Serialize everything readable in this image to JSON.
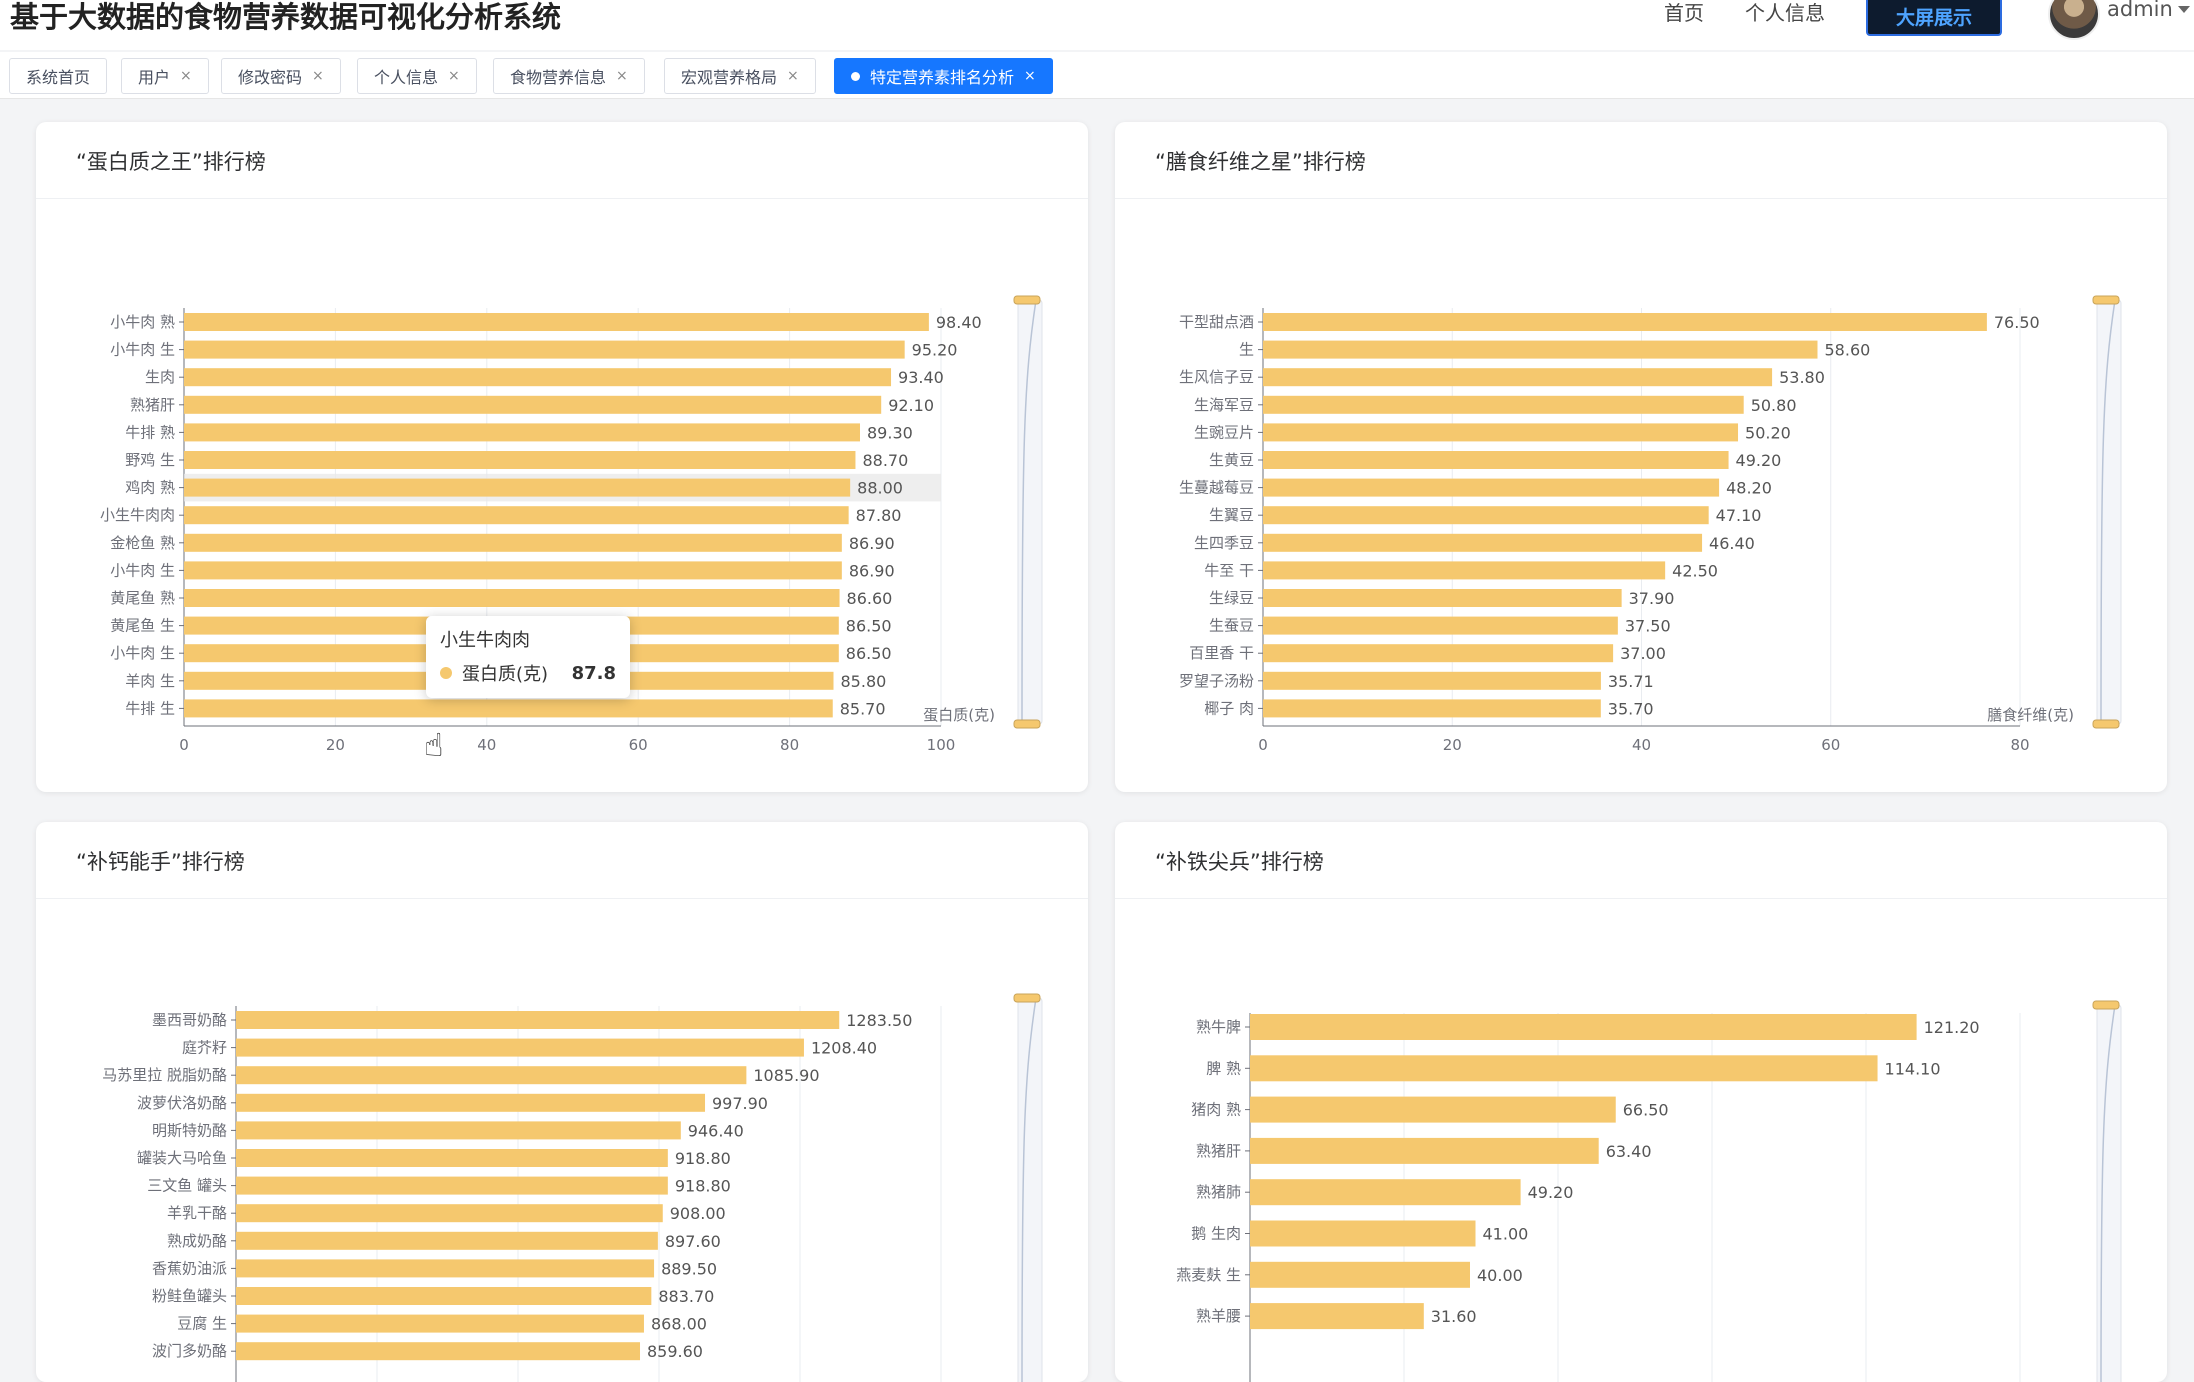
{
  "header": {
    "title": "基于大数据的食物营养数据可视化分析系统",
    "nav": [
      "首页",
      "个人信息"
    ],
    "screen_button": "大屏展示",
    "username": "admin"
  },
  "tabs": [
    {
      "label": "系统首页",
      "closable": false,
      "active": false
    },
    {
      "label": "用户",
      "closable": true,
      "active": false
    },
    {
      "label": "修改密码",
      "closable": true,
      "active": false
    },
    {
      "label": "个人信息",
      "closable": true,
      "active": false
    },
    {
      "label": "食物营养信息",
      "closable": true,
      "active": false
    },
    {
      "label": "宏观营养格局",
      "closable": true,
      "active": false
    },
    {
      "label": "特定营养素排名分析",
      "closable": true,
      "active": true
    }
  ],
  "close_glyph": "×",
  "colors": {
    "bar": "#f5c86e",
    "active_tab": "#1677ff",
    "highlight": "#e8e8e8"
  },
  "tooltip": {
    "title": "小生牛肉肉",
    "series": "蛋白质(克)",
    "value": "87.8"
  },
  "chart_data": [
    {
      "type": "bar",
      "orientation": "horizontal",
      "title": "“蛋白质之王”排行榜",
      "xlabel": "蛋白质(克)",
      "xlim": [
        0,
        100
      ],
      "xticks": [
        0,
        20,
        40,
        60,
        80,
        100
      ],
      "highlight_index": 6,
      "categories": [
        "小牛肉 熟",
        "小牛肉 生",
        "生肉",
        "熟猪肝",
        "牛排 熟",
        "野鸡 生",
        "鸡肉 熟",
        "小生牛肉肉",
        "金枪鱼 熟",
        "小牛肉 生",
        "黄尾鱼 熟",
        "黄尾鱼 生",
        "小牛肉 生",
        "羊肉 生",
        "牛排 生"
      ],
      "values": [
        98.4,
        95.2,
        93.4,
        92.1,
        89.3,
        88.7,
        88.0,
        87.8,
        86.9,
        86.9,
        86.6,
        86.5,
        86.5,
        85.8,
        85.7
      ],
      "labels": [
        "98.40",
        "95.20",
        "93.40",
        "92.10",
        "89.30",
        "88.70",
        "88.00",
        "87.80",
        "86.90",
        "86.90",
        "86.60",
        "86.50",
        "86.50",
        "85.80",
        "85.70"
      ]
    },
    {
      "type": "bar",
      "orientation": "horizontal",
      "title": "“膳食纤维之星”排行榜",
      "xlabel": "膳食纤维(克)",
      "xlim": [
        0,
        80
      ],
      "xticks": [
        0,
        20,
        40,
        60,
        80
      ],
      "categories": [
        "干型甜点酒",
        "生",
        "生风信子豆",
        "生海军豆",
        "生豌豆片",
        "生黄豆",
        "生蔓越莓豆",
        "生翼豆",
        "生四季豆",
        "牛至 干",
        "生绿豆",
        "生蚕豆",
        "百里香 干",
        "罗望子汤粉",
        "椰子 肉"
      ],
      "values": [
        76.5,
        58.6,
        53.8,
        50.8,
        50.2,
        49.2,
        48.2,
        47.1,
        46.4,
        42.5,
        37.9,
        37.5,
        37.0,
        35.71,
        35.7
      ],
      "labels": [
        "76.50",
        "58.60",
        "53.80",
        "50.80",
        "50.20",
        "49.20",
        "48.20",
        "47.10",
        "46.40",
        "42.50",
        "37.90",
        "37.50",
        "37.00",
        "35.71",
        "35.70"
      ]
    },
    {
      "type": "bar",
      "orientation": "horizontal",
      "title": "“补钙能手”排行榜",
      "xlim": [
        0,
        1500
      ],
      "categories": [
        "墨西哥奶酪",
        "庭芥籽",
        "马苏里拉 脱脂奶酪",
        "波萝伏洛奶酪",
        "明斯特奶酪",
        "罐装大马哈鱼",
        "三文鱼 罐头",
        "羊乳干酪",
        "熟成奶酪",
        "香蕉奶油派",
        "粉鲑鱼罐头",
        "豆腐 生",
        "波门多奶酪"
      ],
      "values": [
        1283.5,
        1208.4,
        1085.9,
        997.9,
        946.4,
        918.8,
        918.8,
        908.0,
        897.6,
        889.5,
        883.7,
        868.0,
        859.6
      ],
      "labels": [
        "1283.50",
        "1208.40",
        "1085.90",
        "997.90",
        "946.40",
        "918.80",
        "918.80",
        "908.00",
        "897.60",
        "889.50",
        "883.70",
        "868.00",
        "859.60"
      ]
    },
    {
      "type": "bar",
      "orientation": "horizontal",
      "title": "“补铁尖兵”排行榜",
      "xlim": [
        0,
        140
      ],
      "categories": [
        "熟牛脾",
        "脾 熟",
        "猪肉 熟",
        "熟猪肝",
        "熟猪肺",
        "鹅 生肉",
        "燕麦麸 生",
        "熟羊腰"
      ],
      "values": [
        121.2,
        114.1,
        66.5,
        63.4,
        49.2,
        41.0,
        40.0,
        31.6
      ],
      "labels": [
        "121.20",
        "114.10",
        "66.50",
        "63.40",
        "49.20",
        "41.00",
        "40.00",
        "31.60"
      ]
    }
  ]
}
